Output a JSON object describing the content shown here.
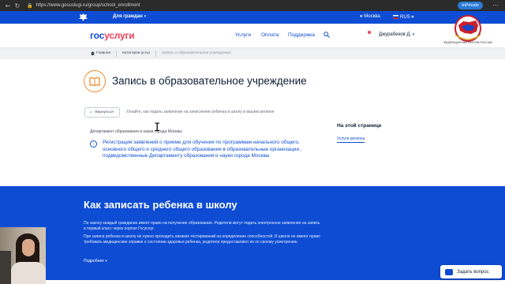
{
  "browser": {
    "url": "https://www.gosuslugi.ru/group/school_enrollment",
    "inprivate_label": "InPrivate"
  },
  "gov_bar": {
    "link_label": "Для граждан",
    "city": "Москва",
    "language": "RUS"
  },
  "header": {
    "logo_part1": "гос",
    "logo_part2": "услуги",
    "nav": [
      "Услуги",
      "Оплата",
      "Поддержка"
    ],
    "user_name": "Джурабеков Д."
  },
  "overlay_logo": {
    "text": "ФЕДЕРАЦИЯ МИГРАНТОВ РОССИИ"
  },
  "breadcrumbs": [
    "Главная",
    "Категории услуг",
    "Запись в образовательное учреждение"
  ],
  "page": {
    "title": "Запись в образовательное учреждение",
    "back_label": "Вернуться",
    "subtitle": "Узнайте, как подать заявление на зачисление ребенка в школу в вашем регионе",
    "department": "Департамент образования и науки города Москвы",
    "registration_link": "Регистрация заявлений о приеме для обучения по программам начального общего, основного общего и среднего общего образования в образовательные организации , подведомственные Департаменту образования и науки города Москвы"
  },
  "sidebar": {
    "title": "На этой странице",
    "link": "Услуги региона"
  },
  "info_section": {
    "title": "Как записать ребенка в школу",
    "paragraph1": "По закону каждый гражданин имеет право на получение образования. Родители могут подать электронное заявление на запись в первый класс через портал Госуслуг.",
    "paragraph2": "При записи ребенка в школу не нужно проходить никаких тестирований на определение способностей. В школе не имеют право требовать медицинские справки о состоянии здоровья ребенка, родители предоставляют их по своему усмотрению.",
    "more_label": "Подробнее"
  },
  "ask_button": {
    "label": "Задать вопрос"
  },
  "colors": {
    "brand_blue": "#0d4cd3",
    "brand_red": "#ee3f58",
    "accent_orange": "#f08a24"
  }
}
